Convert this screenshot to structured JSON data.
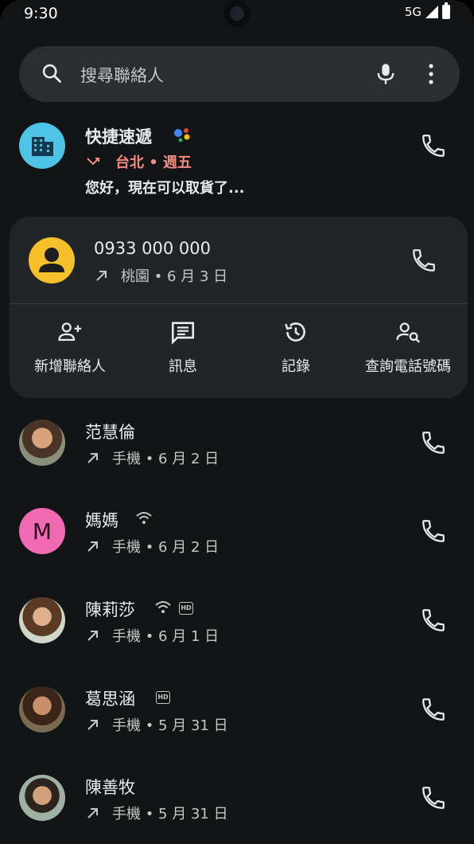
{
  "status_bar": {
    "time": "9:30",
    "network": "5G"
  },
  "search": {
    "placeholder": "搜尋聯絡人"
  },
  "business": {
    "name": "快捷速遞",
    "meta": "台北 • 週五",
    "message": "您好，現在可以取貨了..."
  },
  "expanded": {
    "number": "0933 000 000",
    "meta": "桃園 • 6 月 3 日",
    "actions": [
      {
        "label": "新增聯絡人",
        "icon": "add-person-icon"
      },
      {
        "label": "訊息",
        "icon": "message-icon"
      },
      {
        "label": "記錄",
        "icon": "history-icon"
      },
      {
        "label": "查詢電話號碼",
        "icon": "person-search-icon"
      }
    ]
  },
  "contacts": [
    {
      "name": "范慧倫",
      "meta": "手機 • 6 月 2 日"
    },
    {
      "name": "媽媽",
      "initial": "M",
      "meta": "手機 • 6 月 2 日"
    },
    {
      "name": "陳莉莎",
      "meta": "手機 • 6 月 1 日"
    },
    {
      "name": "葛思涵",
      "meta": "手機 • 5 月 31 日"
    },
    {
      "name": "陳善牧",
      "meta": "手機 • 5 月 31 日"
    }
  ],
  "badges": {
    "hd": "HD"
  },
  "colors": {
    "background": "#121416",
    "card": "#222427",
    "missed": "#f28b82",
    "business_avatar": "#4fc3e6",
    "mom_avatar": "#f06bb4",
    "unknown_avatar": "#f5c02b"
  }
}
